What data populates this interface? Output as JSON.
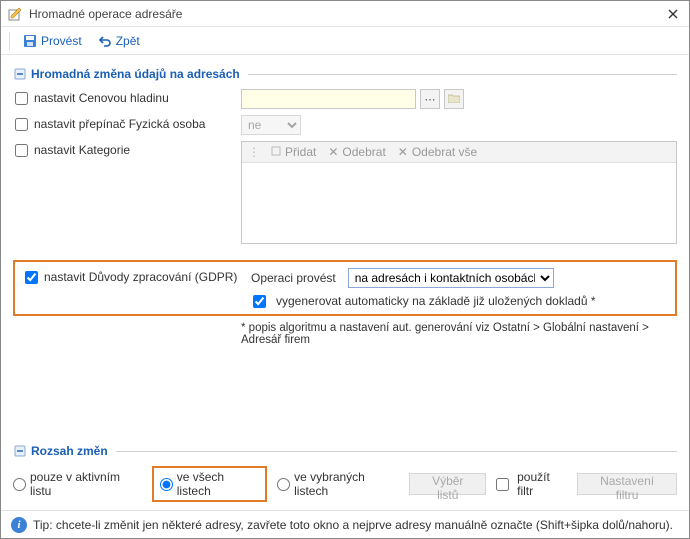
{
  "window": {
    "title": "Hromadné operace adresáře"
  },
  "toolbar": {
    "run_label": "Provést",
    "undo_label": "Zpět"
  },
  "section1": {
    "title": "Hromadná změna údajů na adresách",
    "price_level_label": "nastavit Cenovou hladinu",
    "phys_person_label": "nastavit přepínač Fyzická osoba",
    "phys_person_value": "ne",
    "categories_label": "nastavit Kategorie",
    "cat_add": "Přidat",
    "cat_remove": "Odebrat",
    "cat_remove_all": "Odebrat vše"
  },
  "gdpr": {
    "set_label": "nastavit Důvody zpracování (GDPR)",
    "op_label": "Operaci provést",
    "op_value": "na adresách i kontaktních osobách",
    "auto_label": "vygenerovat automaticky na základě již uložených dokladů *",
    "note": "* popis algoritmu a nastavení aut. generování viz Ostatní > Globální nastavení > Adresář firem"
  },
  "scope": {
    "title": "Rozsah změn",
    "r1": "pouze v aktivním listu",
    "r2": "ve všech listech",
    "r3": "ve vybraných listech",
    "pick_btn": "Výběr listů",
    "use_filter": "použít filtr",
    "filter_btn": "Nastavení filtru"
  },
  "tip": "Tip: chcete-li změnit jen některé adresy, zavřete toto okno a nejprve adresy manuálně označte (Shift+šipka dolů/nahoru)."
}
